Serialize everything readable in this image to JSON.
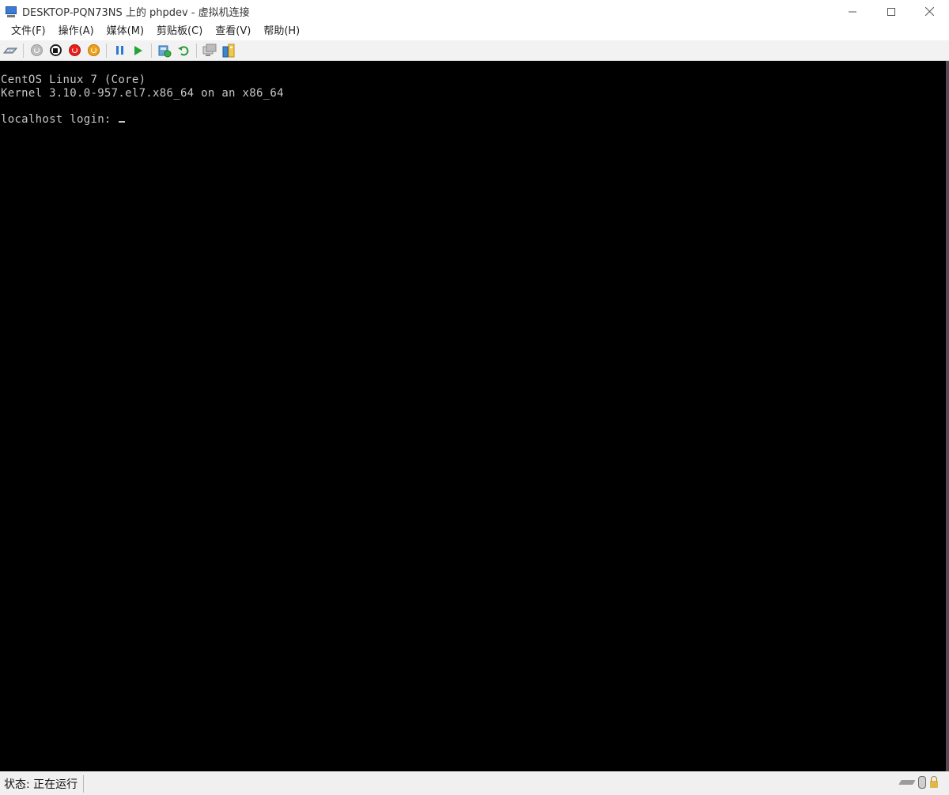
{
  "window": {
    "title": "DESKTOP-PQN73NS 上的 phpdev - 虚拟机连接",
    "controls": [
      "minimize-icon",
      "maximize-icon",
      "close-icon"
    ]
  },
  "menu": {
    "items": [
      {
        "label": "文件(F)"
      },
      {
        "label": "操作(A)"
      },
      {
        "label": "媒体(M)"
      },
      {
        "label": "剪贴板(C)"
      },
      {
        "label": "查看(V)"
      },
      {
        "label": "帮助(H)"
      }
    ]
  },
  "toolbar": {
    "buttons": [
      "ctrl-alt-del-icon",
      "start-icon",
      "turn-off-icon",
      "shutdown-icon",
      "save-icon",
      "pause-icon",
      "resume-icon",
      "checkpoint-icon",
      "revert-icon",
      "enhanced-session-icon",
      "share-icon"
    ]
  },
  "console": {
    "lines": [
      "CentOS Linux 7 (Core)",
      "Kernel 3.10.0-957.el7.x86_64 on an x86_64",
      "",
      "localhost login: "
    ]
  },
  "status": {
    "text": "状态: 正在运行"
  },
  "colors": {
    "console_bg": "#000000",
    "console_fg": "#c7c7c7",
    "toolbar_bg": "#f2f2f2"
  }
}
